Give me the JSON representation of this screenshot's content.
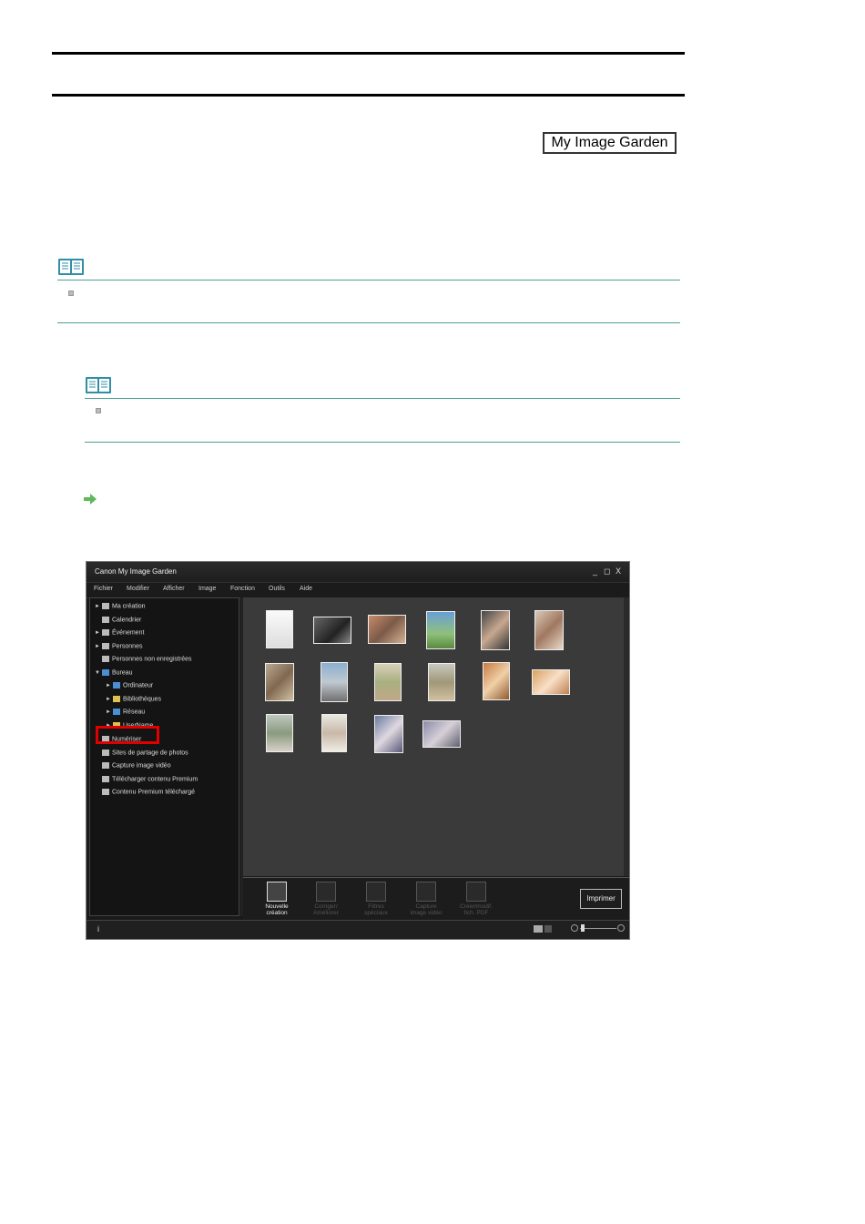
{
  "header": {
    "badge_label": "My Image Garden"
  },
  "app": {
    "title": "Canon My Image Garden",
    "window_controls": [
      "_",
      "◻",
      "X"
    ],
    "menu": [
      "Fichier",
      "Modifier",
      "Afficher",
      "Image",
      "Fonction",
      "Outils",
      "Aide"
    ],
    "tree": [
      {
        "label": "Ma création",
        "twisty": "►",
        "indent": 0
      },
      {
        "label": "Calendrier",
        "twisty": "",
        "indent": 0
      },
      {
        "label": "Événement",
        "twisty": "►",
        "indent": 0
      },
      {
        "label": "Personnes",
        "twisty": "►",
        "indent": 0
      },
      {
        "label": "Personnes non enregistrées",
        "twisty": "",
        "indent": 0
      },
      {
        "label": "Bureau",
        "twisty": "▼",
        "indent": 0
      },
      {
        "label": "Ordinateur",
        "twisty": "►",
        "indent": 1
      },
      {
        "label": "Bibliothèques",
        "twisty": "►",
        "indent": 1
      },
      {
        "label": "Réseau",
        "twisty": "►",
        "indent": 1
      },
      {
        "label": "UserName",
        "twisty": "►",
        "indent": 1
      },
      {
        "label": "Numériser",
        "twisty": "",
        "indent": 0
      },
      {
        "label": "Sites de partage de photos",
        "twisty": "",
        "indent": 0
      },
      {
        "label": "Capture image vidéo",
        "twisty": "",
        "indent": 0
      },
      {
        "label": "Télécharger contenu Premium",
        "twisty": "",
        "indent": 0
      },
      {
        "label": "Contenu Premium téléchargé",
        "twisty": "",
        "indent": 0
      }
    ],
    "toolbar": [
      {
        "line1": "Nouvelle",
        "line2": "création",
        "enabled": true
      },
      {
        "line1": "Corriger/",
        "line2": "Améliorer",
        "enabled": false
      },
      {
        "line1": "Filtres",
        "line2": "spéciaux",
        "enabled": false
      },
      {
        "line1": "Capture",
        "line2": "image vidéo",
        "enabled": false
      },
      {
        "line1": "Créer/modif.",
        "line2": "fich. PDF",
        "enabled": false
      }
    ],
    "print_button": "Imprimer",
    "status_info": "i"
  },
  "colors": {
    "note_accent": "#4aa08f",
    "highlight": "#e00000",
    "link_arrow": "#5fb85a"
  }
}
